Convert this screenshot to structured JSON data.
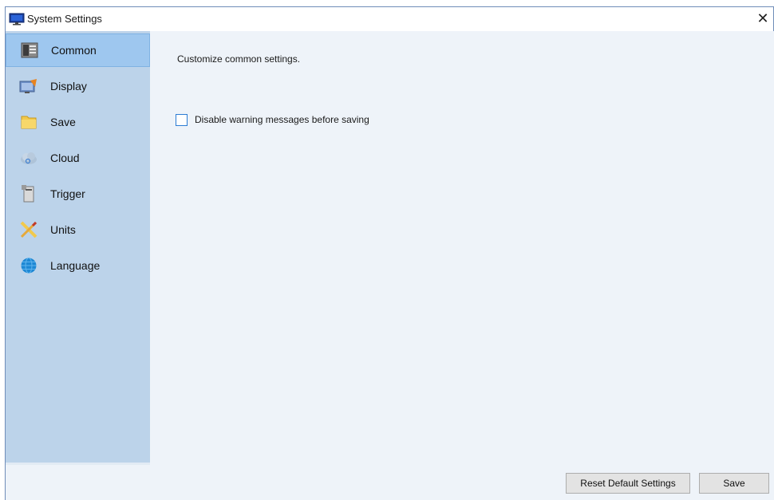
{
  "window": {
    "title": "System Settings",
    "close_glyph": "✕"
  },
  "sidebar": {
    "items": [
      {
        "label": "Common",
        "icon": "common-settings-icon",
        "selected": true
      },
      {
        "label": "Display",
        "icon": "display-icon",
        "selected": false
      },
      {
        "label": "Save",
        "icon": "folder-icon",
        "selected": false
      },
      {
        "label": "Cloud",
        "icon": "cloud-icon",
        "selected": false
      },
      {
        "label": "Trigger",
        "icon": "trigger-icon",
        "selected": false
      },
      {
        "label": "Units",
        "icon": "ruler-icon",
        "selected": false
      },
      {
        "label": "Language",
        "icon": "globe-icon",
        "selected": false
      }
    ]
  },
  "main": {
    "description": "Customize common settings.",
    "option": {
      "label": "Disable warning messages before saving",
      "checked": false
    }
  },
  "footer": {
    "reset_label": "Reset Default Settings",
    "save_label": "Save"
  },
  "colors": {
    "sidebar_bg": "#bcd3ea",
    "selected_bg": "#9ec7ef",
    "content_bg": "#eef3f9",
    "checkbox_border": "#2c7cd4"
  }
}
